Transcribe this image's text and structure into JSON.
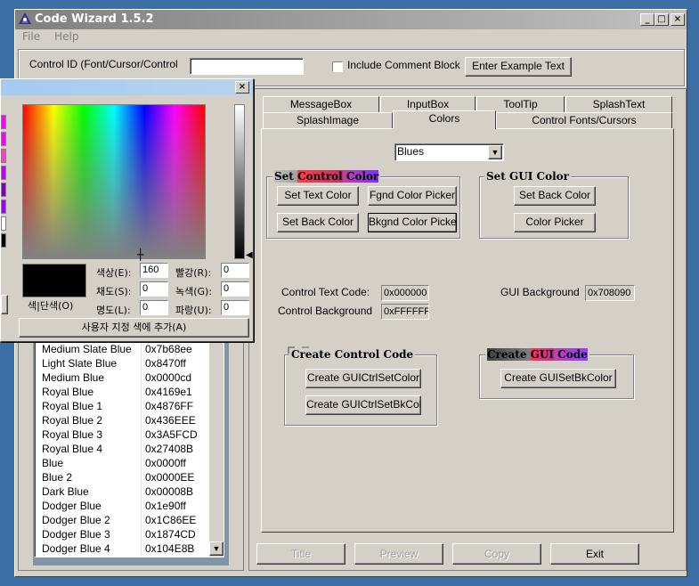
{
  "window": {
    "title": "Code Wizard 1.5.2",
    "minimize": "_",
    "maximize": "□",
    "close": "×"
  },
  "menu": [
    "File",
    "Help"
  ],
  "top": {
    "control_id_label": "Control ID (Font/Cursor/Control",
    "control_id_value": "",
    "include_comment_label": "Include Comment Block",
    "enter_example_label": "Enter Example Text"
  },
  "tabs_row1": [
    "MessageBox",
    "InputBox",
    "ToolTip",
    "SplashText"
  ],
  "tabs_row2": [
    "SplashImage",
    "Colors",
    "Control Fonts/Cursors"
  ],
  "colors_tab": {
    "palette_select": "Blues",
    "set_control": {
      "title_a": "Set ",
      "title_b": "Control",
      "title_c": " Color",
      "set_text": "Set Text Color",
      "fgnd_picker": "Fgnd Color Picker",
      "set_back": "Set Back Color",
      "bkgnd_picker": "Bkgnd Color Picker"
    },
    "set_gui": {
      "title": "Set GUI Color",
      "set_back": "Set Back Color",
      "picker": "Color Picker"
    },
    "control_text_label": "Control Text Code:",
    "control_text_value": "0x000000",
    "control_back_label": "Control Background",
    "control_back_value": "0xFFFFFF",
    "gui_back_label": "GUI Background",
    "gui_back_value": "0x708090",
    "create_control": {
      "title": "Create Control Code",
      "btn1": "Create GUICtrlSetColor",
      "btn2": "Create GUICtrlSetBkColor"
    },
    "create_gui": {
      "title_a": "Create ",
      "title_b": "GUI",
      "title_c": " Code",
      "btn": "Create GUISetBkColor"
    }
  },
  "bottom_buttons": {
    "title": "Title",
    "preview": "Preview",
    "copy": "Copy",
    "exit": "Exit"
  },
  "color_list": [
    [
      "Medium Slate Blue",
      "0x7b68ee"
    ],
    [
      "Light Slate Blue",
      "0x8470ff"
    ],
    [
      "Medium Blue",
      "0x0000cd"
    ],
    [
      "Royal Blue",
      "0x4169e1"
    ],
    [
      "Royal Blue 1",
      "0x4876FF"
    ],
    [
      "Royal Blue 2",
      "0x436EEE"
    ],
    [
      "Royal Blue 3",
      "0x3A5FCD"
    ],
    [
      "Royal Blue 4",
      "0x27408B"
    ],
    [
      "Blue",
      "0x0000ff"
    ],
    [
      "Blue 2",
      "0x0000EE"
    ],
    [
      "Dark Blue",
      "0x00008B"
    ],
    [
      "Dodger Blue",
      "0x1e90ff"
    ],
    [
      "Dodger Blue 2",
      "0x1C86EE"
    ],
    [
      "Dodger Blue 3",
      "0x1874CD"
    ],
    [
      "Dodger Blue 4",
      "0x104E8B"
    ]
  ],
  "color_dialog": {
    "close": "×",
    "hue_label": "색상(E):",
    "hue_value": "160",
    "sat_label": "채도(S):",
    "sat_value": "0",
    "lum_label": "명도(L):",
    "lum_value": "0",
    "red_label": "빨강(R):",
    "red_value": "0",
    "green_label": "녹색(G):",
    "green_value": "0",
    "blue_label": "파랑(U):",
    "blue_value": "0",
    "solid_label": "색|단색(O)",
    "add_custom": "사용자 지정 색에 추가(A)"
  },
  "colors": {
    "swatch_dark": "#000000",
    "swatch_strip": [
      "#ff00ff",
      "#ff00ff",
      "#ff40c0",
      "#c000ff",
      "#8000c0",
      "#a000ff",
      "#ffffff",
      "#000000"
    ]
  }
}
